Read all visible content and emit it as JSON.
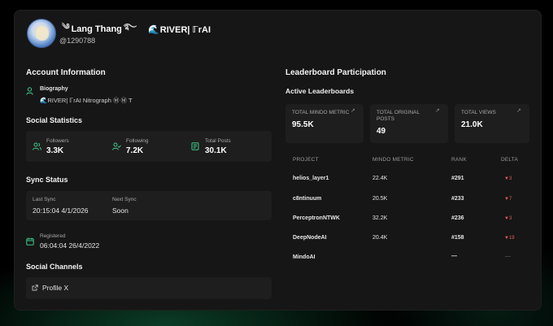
{
  "profile": {
    "name_prefix_ornament": "༄",
    "display_name": "Lang Thang",
    "name_suffix_ornament": "࿐",
    "name_wave": "🌊",
    "team": "RIVER| ℾrAI",
    "handle": "@1290788"
  },
  "left": {
    "account_info_title": "Account Information",
    "biography_label": "Biography",
    "biography_text": "🌊RIVER| ℾrAI Nitrograph Ⓜ Ⓜ T",
    "social_stats_title": "Social Statistics",
    "stats": [
      {
        "label": "Followers",
        "value": "3.3K"
      },
      {
        "label": "Following",
        "value": "7.2K"
      },
      {
        "label": "Total Posts",
        "value": "30.1K"
      }
    ],
    "sync_title": "Sync Status",
    "last_sync_label": "Last Sync",
    "last_sync_value": "20:15:04 4/1/2026",
    "next_sync_label": "Next Sync",
    "next_sync_value": "Soon",
    "registered_label": "Registered",
    "registered_value": "06:04:04 26/4/2022",
    "social_channels_title": "Social Channels",
    "profile_x_label": "Profile X"
  },
  "right": {
    "leaderboard_title": "Leaderboard Participation",
    "active_title": "Active Leaderboards",
    "metrics": [
      {
        "label": "TOTAL MINDO METRIC",
        "value": "95.5K"
      },
      {
        "label": "TOTAL ORIGINAL POSTS",
        "value": "49"
      },
      {
        "label": "TOTAL VIEWS",
        "value": "21.0K"
      }
    ],
    "table": {
      "headers": [
        "PROJECT",
        "MINDO METRIC",
        "RANK",
        "DELTA"
      ],
      "rows": [
        {
          "project": "helios_layer1",
          "metric": "22.4K",
          "rank": "#291",
          "delta": "▼3"
        },
        {
          "project": "c8ntinuum",
          "metric": "20.5K",
          "rank": "#233",
          "delta": "▼7"
        },
        {
          "project": "PerceptronNTWK",
          "metric": "32.2K",
          "rank": "#236",
          "delta": "▼3"
        },
        {
          "project": "DeepNodeAI",
          "metric": "20.4K",
          "rank": "#158",
          "delta": "▼19"
        },
        {
          "project": "MindoAI",
          "metric": "",
          "rank": "—",
          "delta": "—"
        }
      ]
    }
  },
  "colors": {
    "accent_green": "#3ec98a",
    "delta_red": "#e35a5a",
    "card_bg": "#161616",
    "box_bg": "#1e1e1e"
  },
  "icons": {
    "biography": "person-icon",
    "followers": "users-icon",
    "following": "user-check-icon",
    "posts": "newspaper-icon",
    "registered": "calendar-icon",
    "profile_x": "external-link-icon",
    "trend": "trend-up-icon"
  }
}
